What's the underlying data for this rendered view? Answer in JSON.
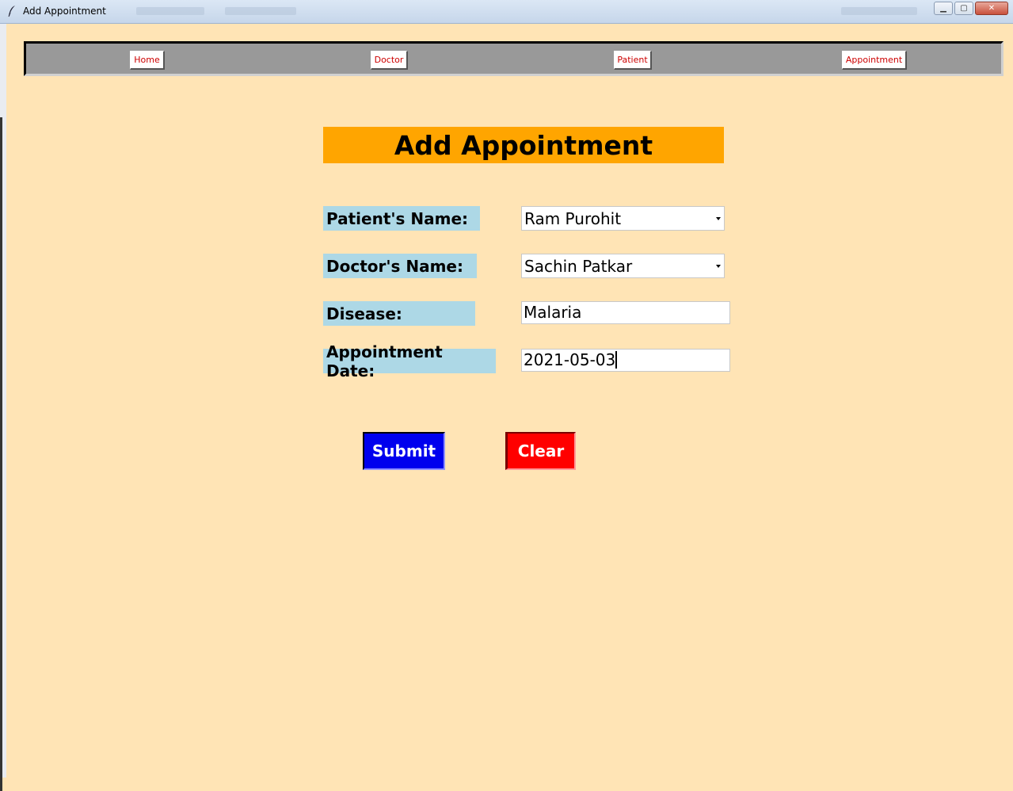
{
  "window": {
    "title": "Add Appointment",
    "minimize": "▁",
    "maximize": "▢",
    "close": "✕"
  },
  "nav": {
    "items": [
      {
        "label": "Home"
      },
      {
        "label": "Doctor"
      },
      {
        "label": "Patient"
      },
      {
        "label": "Appointment"
      }
    ]
  },
  "form": {
    "heading": "Add Appointment",
    "patient_label": "Patient's Name:",
    "patient_value": "Ram Purohit",
    "doctor_label": "Doctor's Name:",
    "doctor_value": "Sachin Patkar",
    "disease_label": "Disease:",
    "disease_value": "Malaria",
    "date_label": "Appointment Date:",
    "date_value": "2021-05-03",
    "submit_label": "Submit",
    "clear_label": "Clear"
  },
  "colors": {
    "background": "#ffe4b5",
    "heading_bg": "#ffa500",
    "label_bg": "#add8e6",
    "nav_bg": "#999999",
    "nav_text": "#cc0000",
    "submit_bg": "#0000ee",
    "clear_bg": "#ff0000"
  }
}
